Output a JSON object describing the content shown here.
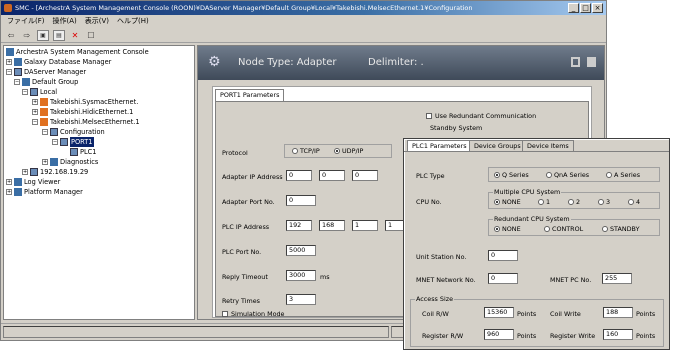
{
  "window": {
    "title": "SMC - [ArchestrA System Management Console (ROON)¥DAServer Manager¥Default Group¥Local¥Takebishi.MelsecEthernet.1¥Configuration"
  },
  "menu": [
    "ファイル(F)",
    "操作(A)",
    "表示(V)",
    "ヘルプ(H)"
  ],
  "tree": {
    "root": "ArchestrA System Management Console",
    "galaxy": "Galaxy Database Manager",
    "daserver": "DAServer Manager",
    "default_group": "Default Group",
    "local": "Local",
    "sysmac": "Takebishi.SysmacEthernet.",
    "hidic": "Takebishi.HidicEthernet.1",
    "melsec": "Takebishi.MelsecEthernet.1",
    "configuration": "Configuration",
    "port1": "PORT1",
    "plc1": "PLC1",
    "diagnostics": "Diagnostics",
    "ip_node": "192.168.19.29",
    "log_viewer": "Log Viewer",
    "platform_manager": "Platform Manager"
  },
  "node_header": {
    "title": "Node Type: Adapter",
    "delimiter": "Delimiter: ."
  },
  "port1": {
    "tab_label": "PORT1 Parameters",
    "use_redundant": "Use Redundant Communication",
    "standby_system": "Standby System",
    "protocol_label": "Protocol",
    "protocol_options": [
      "TCP/IP",
      "UDP/IP"
    ],
    "adapter_ip_label": "Adapter IP Address",
    "adapter_ip": [
      "0",
      "0",
      "0"
    ],
    "adapter_port_label": "Adapter Port No.",
    "adapter_port": "0",
    "plc_ip_label": "PLC IP Address",
    "plc_ip": [
      "192",
      "168",
      "1",
      "1"
    ],
    "plc_port_label": "PLC Port No.",
    "plc_port": "5000",
    "reply_timeout_label": "Reply Timeout",
    "reply_timeout": "3000",
    "reply_timeout_unit": "ms",
    "retry_label": "Retry Times",
    "retry": "3",
    "simulation_mode": "Simulation Mode"
  },
  "plc1": {
    "tabs": [
      "PLC1 Parameters",
      "Device Groups",
      "Device Items"
    ],
    "plc_type_label": "PLC Type",
    "plc_type_options": [
      "Q Series",
      "QnA Series",
      "A Series"
    ],
    "cpu_no_label": "CPU No.",
    "multiple_cpu_title": "Multiple CPU System",
    "cpu_options": [
      "NONE",
      "1",
      "2",
      "3",
      "4"
    ],
    "redundant_cpu_title": "Redundant CPU System",
    "redundant_options": [
      "NONE",
      "CONTROL",
      "STANDBY"
    ],
    "unit_station_label": "Unit Station No.",
    "unit_station": "0",
    "mnet_network_label": "MNET Network No.",
    "mnet_network": "0",
    "mnet_pc_label": "MNET PC No.",
    "mnet_pc": "255",
    "access_size_title": "Access Size",
    "coil_rw_label": "Coil R/W",
    "coil_rw": "15360",
    "coil_write_label": "Coil Write",
    "coil_write": "188",
    "register_rw_label": "Register R/W",
    "register_rw": "960",
    "register_write_label": "Register Write",
    "register_write": "160",
    "points": "Points"
  }
}
